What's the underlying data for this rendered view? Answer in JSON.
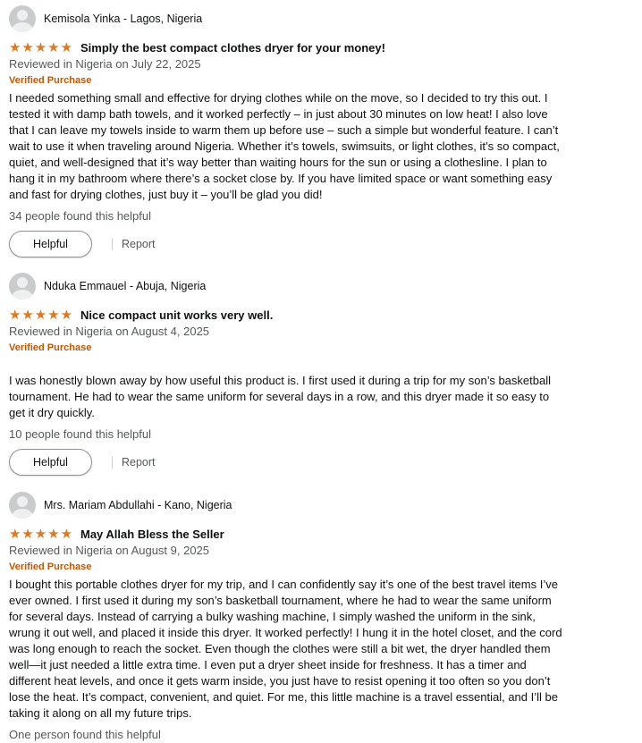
{
  "colors": {
    "star": "#de7921",
    "verified": "#c45500",
    "muted": "#565959",
    "text": "#0f1111"
  },
  "icons": {
    "avatar": "default-profile-avatar-icon",
    "star": "filled-star-icon"
  },
  "reviews": [
    {
      "profile_name": "Kemisola Yinka - Lagos, Nigeria",
      "rating": 5,
      "title": "Simply the best compact clothes dryer for your money!",
      "date": "Reviewed in Nigeria on July 22, 2025",
      "verified": "Verified Purchase",
      "body": "I needed something small and effective for drying clothes while on the move, so I decided to try this out. I tested it with damp bath towels, and it worked perfectly – in just about 30 minutes on low heat! I also love that I can leave my towels inside to warm them up before use – such a simple but wonderful feature. I can’t wait to use it when traveling around Nigeria. Whether it’s towels, swimsuits, or light clothes, it’s so compact, quiet, and well-designed that it’s way better than waiting hours for the sun or using a clothesline. I plan to hang it in my bathroom where there’s a socket close by. If you have limited space or want something easy and fast for drying clothes, just buy it – you’ll be glad you did!",
      "helpful_count": "34 people found this helpful",
      "helpful_button": "Helpful",
      "report": "Report"
    },
    {
      "profile_name": "Nduka Emmauel - Abuja, Nigeria",
      "rating": 5,
      "title": "Nice compact unit works very well.",
      "date": "Reviewed in Nigeria on August 4, 2025",
      "verified": "Verified Purchase",
      "body": "I was honestly blown away by how useful this product is. I first used it during a trip for my son’s basketball tournament. He had to wear the same uniform for several days in a row, and this dryer made it so easy to get it dry quickly.",
      "helpful_count": "10 people found this helpful",
      "helpful_button": "Helpful",
      "report": "Report"
    },
    {
      "profile_name": "Mrs. Mariam Abdullahi - Kano, Nigeria",
      "rating": 5,
      "title": "May Allah Bless the Seller",
      "date": "Reviewed in Nigeria on August 9, 2025",
      "verified": "Verified Purchase",
      "body": "I bought this portable clothes dryer for my trip, and I can confidently say it’s one of the best travel items I’ve ever owned. I first used it during my son’s basketball tournament, where he had to wear the same uniform for several days. Instead of carrying a bulky washing machine, I simply washed the uniform in the sink, wrung it out well, and placed it inside this dryer. It worked perfectly! I hung it in the hotel closet, and the cord was long enough to reach the socket. Even though the clothes were still a bit wet, the dryer handled them well—it just needed a little extra time. I even put a dryer sheet inside for freshness. It has a timer and different heat levels, and once it gets warm inside, you just have to resist opening it too often so you don’t lose the heat. It’s compact, convenient, and quiet. For me, this little machine is a travel essential, and I’ll be taking it along on all my future trips.",
      "helpful_count": "One person found this helpful"
    }
  ]
}
